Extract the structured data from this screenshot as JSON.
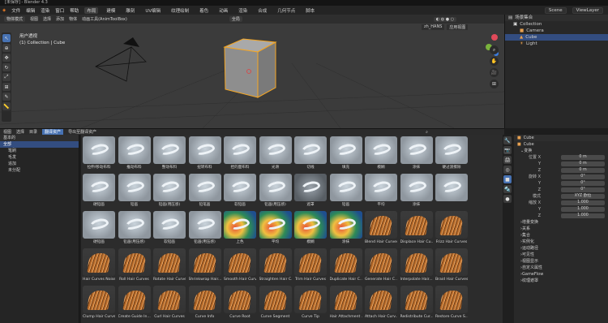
{
  "window_title": "[未保存] - Blender 4.3",
  "menu": {
    "items": [
      "文件",
      "编辑",
      "渲染",
      "窗口",
      "帮助"
    ],
    "tabs": [
      "布局",
      "建模",
      "雕刻",
      "UV编辑",
      "纹理绘制",
      "着色",
      "动画",
      "渲染",
      "合成",
      "几何节点",
      "脚本"
    ],
    "active_tab": "布局",
    "scene": "Scene",
    "view_layer": "ViewLayer"
  },
  "viewport": {
    "mode": "物体模式",
    "menus": [
      "视图",
      "选择",
      "添加",
      "物体"
    ],
    "extra": "动画工具(AnimToolBox)",
    "orientation": "全局",
    "view_name": "用户透视",
    "collection_info": "(1) Collection | Cube",
    "lang_button": "zh_HANS",
    "apply_button": "应用视图"
  },
  "outliner": {
    "title": "场景集合",
    "rows": [
      {
        "label": "Collection",
        "icon": "collection-icon"
      },
      {
        "label": "Camera",
        "icon": "camera-icon"
      },
      {
        "label": "Cube",
        "icon": "cube-icon"
      },
      {
        "label": "Light",
        "icon": "light-icon"
      }
    ]
  },
  "asset_browser": {
    "header": [
      "视图",
      "选择",
      "目录"
    ],
    "highlight": "翻译资产",
    "extra": "导出至翻译资产",
    "library": "基本的",
    "left_rows": [
      {
        "label": "全部",
        "selected": true
      },
      {
        "label": "笔刷",
        "selected": false
      },
      {
        "label": "毛发",
        "selected": false
      },
      {
        "label": "追加",
        "selected": false
      },
      {
        "label": "未分配",
        "selected": false
      }
    ],
    "tiles": [
      [
        "拉伸/移动布料",
        "推动布料",
        "整动布料",
        "扭转布料",
        "捏的面布料",
        "光滑",
        "切线",
        "填充",
        "模糊",
        "涂抹",
        "硬过渡擦除"
      ],
      [
        "硬铅画",
        "铅画",
        "铅画(用压感)",
        "铅笔画",
        "软铅画",
        "铅画(用压感)",
        "遮罩",
        "铅画",
        "平均",
        "涂抹",
        ""
      ],
      [
        "硬铅画",
        "铅画(用压感)",
        "软铅画",
        "铅画(用压感)",
        "上色",
        "平均",
        "模糊",
        "涂抹",
        "Blend Hair Curves",
        "Displace Hair Cu...",
        "Frizz Hair Curves"
      ],
      [
        "Hair Curves Noise",
        "Roll Hair Curves",
        "Rotate Hair Curves",
        "Shrinkwrap Hair...",
        "Smooth Hair Curves",
        "Straighten Hair C...",
        "Trim Hair Curves",
        "Duplicate Hair C...",
        "Generate Hair C...",
        "Interpolate Hair...",
        "Braid Hair Curves"
      ],
      [
        "Clump Hair Curves",
        "Create Guide In...",
        "Curl Hair Curves",
        "Curve Info",
        "Curve Root",
        "Curve Segment",
        "Curve Tip",
        "Hair Attachment ...",
        "Attach Hair Curv...",
        "Redistribute Cur...",
        "Restore Curve S..."
      ]
    ]
  },
  "properties": {
    "object_name": "Cube",
    "data_name": "Cube",
    "section_transform": "变换",
    "location_label": "位置 X",
    "rotation_label": "旋转 X",
    "scale_label": "缩放 X",
    "axis_y": "Y",
    "axis_z": "Z",
    "location": [
      "0 m",
      "0 m",
      "0 m"
    ],
    "rotation": [
      "0°",
      "0°",
      "0°"
    ],
    "mode_label": "模式",
    "mode_value": "XYZ 欧拉",
    "scale": [
      "1.000",
      "1.000",
      "1.000"
    ],
    "sections": [
      "增量变换",
      "关系",
      "集合",
      "实例化",
      "运动路径",
      "可见性",
      "视图显示",
      "自定义属性",
      "GameFlow",
      "纹理遮罩"
    ]
  }
}
